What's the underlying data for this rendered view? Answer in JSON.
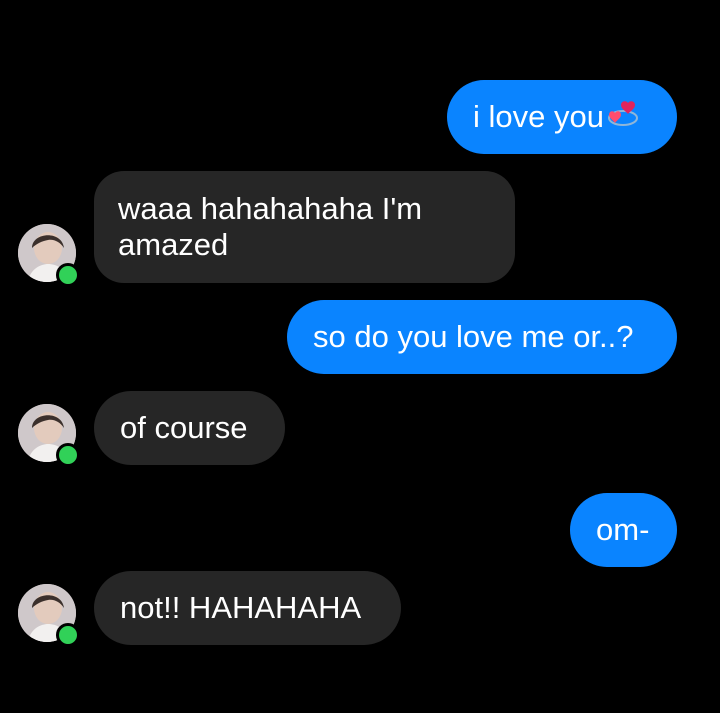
{
  "conversation": {
    "messages": [
      {
        "side": "sent",
        "text": "i love you",
        "emoji": "revolving-hearts-emoji"
      },
      {
        "side": "received",
        "text": "waaa hahahahaha I'm amazed"
      },
      {
        "side": "sent",
        "text": "so do you love me or..?"
      },
      {
        "side": "received",
        "text": "of course"
      },
      {
        "side": "sent",
        "text": "om-"
      },
      {
        "side": "received",
        "text": "not!! HAHAHAHA"
      }
    ],
    "contact": {
      "status": "online"
    }
  },
  "colors": {
    "background": "#000000",
    "sent_bubble": "#0a84ff",
    "received_bubble": "#262626",
    "online_dot": "#31d158",
    "text": "#ffffff"
  }
}
